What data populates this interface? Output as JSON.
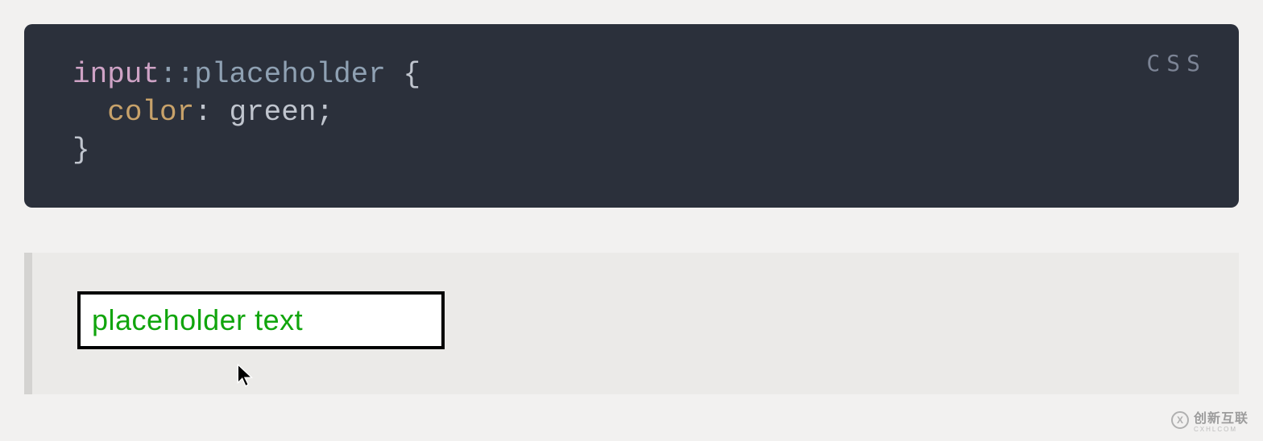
{
  "code": {
    "lang_label": "CSS",
    "line1_selector": "input",
    "line1_pseudo": "::placeholder",
    "line1_space_brace": " {",
    "line2_indent": "  ",
    "line2_prop": "color",
    "line2_colon": ":",
    "line2_space": " ",
    "line2_value": "green",
    "line2_semi": ";",
    "line3_brace": "}"
  },
  "example": {
    "placeholder_text": "placeholder text"
  },
  "watermark": {
    "logo_letter": "X",
    "text": "创新互联",
    "sub": "CXHLCOM"
  }
}
